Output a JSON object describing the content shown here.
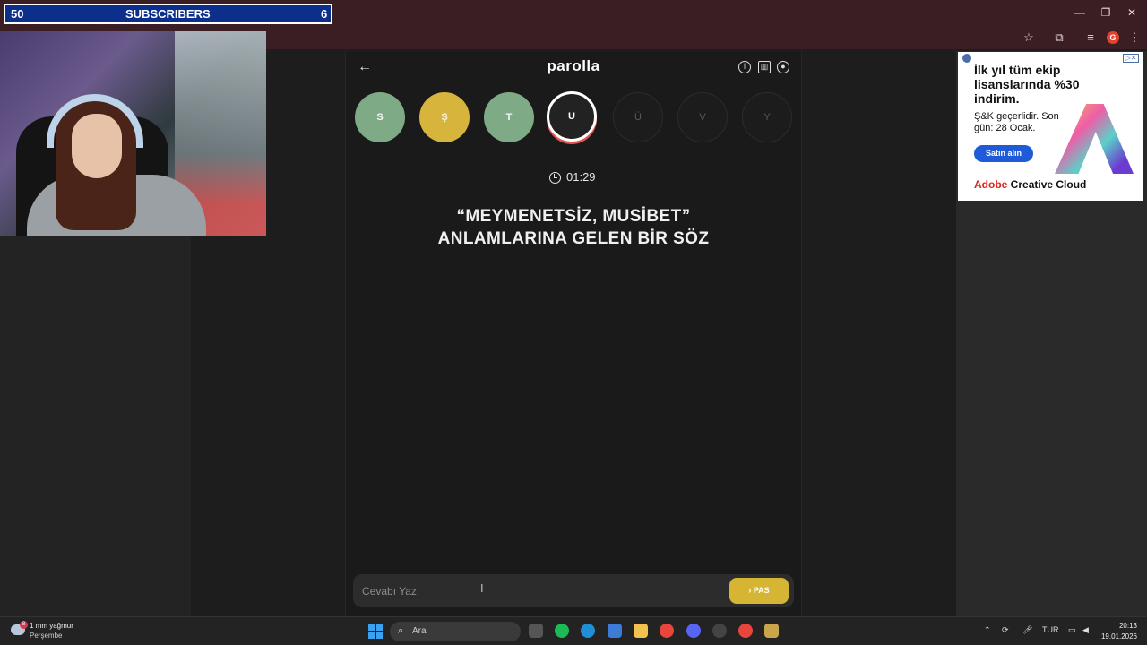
{
  "overlay": {
    "left_num": "50",
    "label": "SUBSCRIBERS",
    "right_num": "6"
  },
  "window_controls": {
    "minimize": "—",
    "restore": "❐",
    "close": "✕"
  },
  "toolbar": {
    "bookmark_icon": "star-icon",
    "extensions_icon": "puzzle-icon",
    "media_icon": "media-icon",
    "profile_initial": "G",
    "menu_icon": "kebab-icon"
  },
  "app": {
    "title": "parolla",
    "back_icon": "←",
    "header_icons": [
      "info-icon",
      "chart-icon",
      "profile-icon"
    ],
    "letters": [
      {
        "char": "S",
        "state": "correct"
      },
      {
        "char": "Ş",
        "state": "passed"
      },
      {
        "char": "T",
        "state": "correct"
      },
      {
        "char": "U",
        "state": "active"
      },
      {
        "char": "Ü",
        "state": "empty"
      },
      {
        "char": "V",
        "state": "empty"
      },
      {
        "char": "Y",
        "state": "empty"
      }
    ],
    "timer": "01:29",
    "question_line1": "“MEYMENETSİZ, MUSİBET”",
    "question_line2": "ANLAMLARINA GELEN BİR SÖZ",
    "answer_placeholder": "Cevabı Yaz",
    "pass_label": "PAS",
    "pass_icon": "›"
  },
  "ad": {
    "headline": "İlk yıl tüm ekip lisanslarında %30 indirim.",
    "sub": "Ş&K geçerlidir. Son gün: 28 Ocak.",
    "button": "Satın alın",
    "brand_red": "Adobe",
    "brand_rest": " Creative Cloud",
    "close_label": "▷✕"
  },
  "taskbar": {
    "weather_line1": "1 mm yağmur",
    "weather_line2": "Perşembe",
    "weather_badge": "8",
    "search_placeholder": "Ara",
    "language": "TUR",
    "time": "20:13",
    "date": "19.01.2026"
  },
  "colors": {
    "correct": "#7eab86",
    "passed": "#d7b43b",
    "accent": "#e05454",
    "pass_button": "#d6b534"
  }
}
